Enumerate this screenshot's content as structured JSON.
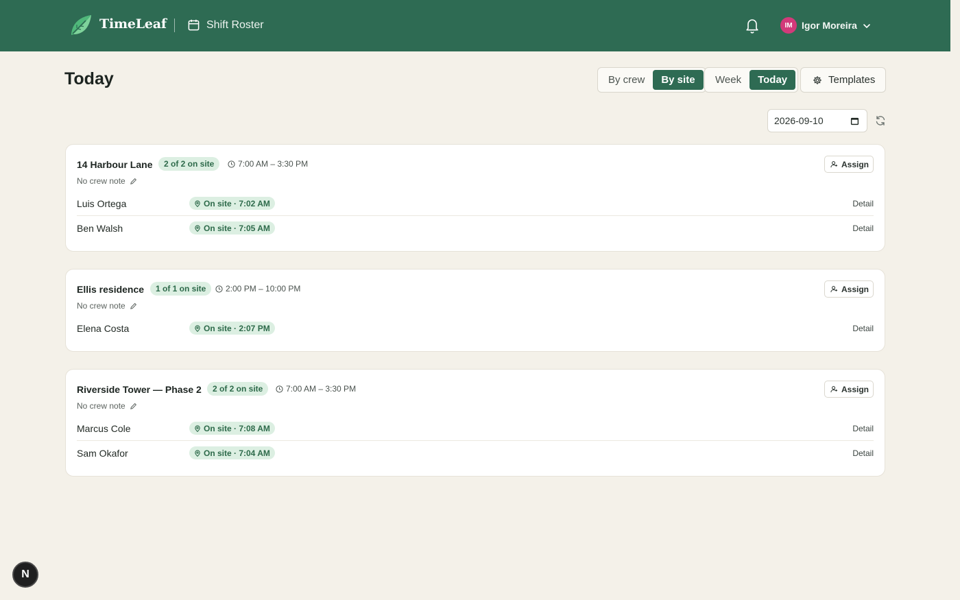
{
  "header": {
    "brand": "TimeLeaf",
    "app_title": "Shift Roster",
    "user": {
      "initials": "IM",
      "name": "Igor Moreira",
      "avatar_color": "#d23a7a"
    },
    "brand_color": "#2e6b53"
  },
  "page": {
    "title": "Today",
    "view_toggle": [
      {
        "label": "By crew",
        "active": false
      },
      {
        "label": "By site",
        "active": true
      }
    ],
    "range_toggle": [
      {
        "label": "Week",
        "active": false
      },
      {
        "label": "Today",
        "active": true
      }
    ],
    "templates_label": "Templates",
    "date_value": "2026-09-10"
  },
  "sites": [
    {
      "name": "14 Harbour Lane",
      "count": "2 of 2 on site",
      "time": "7:00 AM – 3:30 PM",
      "assign_label": "Assign",
      "note": "No crew note",
      "crew": [
        {
          "name": "Luis Ortega",
          "status": "On site · 7:02 AM",
          "detail": "Detail"
        },
        {
          "name": "Ben Walsh",
          "status": "On site · 7:05 AM",
          "detail": "Detail"
        }
      ]
    },
    {
      "name": "Ellis residence",
      "count": "1 of 1 on site",
      "time": "2:00 PM – 10:00 PM",
      "assign_label": "Assign",
      "note": "No crew note",
      "crew": [
        {
          "name": "Elena Costa",
          "status": "On site · 2:07 PM",
          "detail": "Detail"
        }
      ]
    },
    {
      "name": "Riverside Tower — Phase 2",
      "count": "2 of 2 on site",
      "time": "7:00 AM – 3:30 PM",
      "assign_label": "Assign",
      "note": "No crew note",
      "crew": [
        {
          "name": "Marcus Cole",
          "status": "On site · 7:08 AM",
          "detail": "Detail"
        },
        {
          "name": "Sam Okafor",
          "status": "On site · 7:04 AM",
          "detail": "Detail"
        }
      ]
    }
  ],
  "fab_label": "N"
}
